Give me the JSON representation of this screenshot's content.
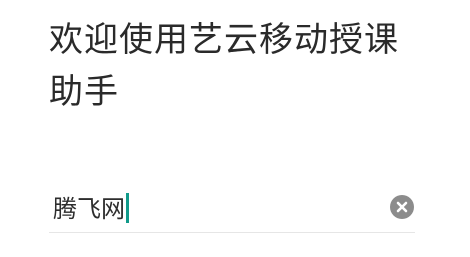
{
  "welcome": {
    "title": "欢迎使用艺云移动授课助手"
  },
  "input": {
    "value": "腾飞网"
  },
  "icons": {
    "clear": "clear-circle-x-icon"
  },
  "colors": {
    "cursor": "#119a8a",
    "clear_icon": "#8c8c8c",
    "divider": "#e6e6e6"
  }
}
